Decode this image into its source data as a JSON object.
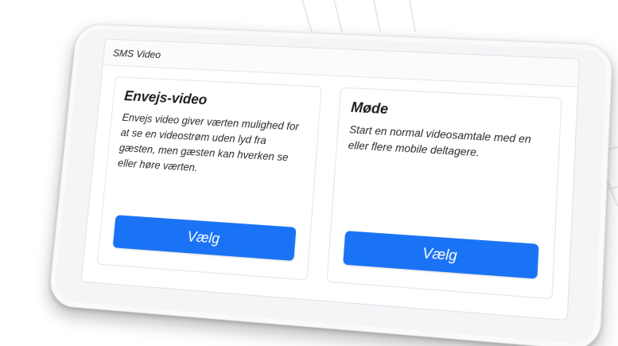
{
  "panel": {
    "title": "SMS Video"
  },
  "options": [
    {
      "title": "Envejs-video",
      "description": "Envejs video giver værten mulighed for at se en videostrøm uden lyd fra gæsten, men gæsten kan hverken se eller høre værten.",
      "button_label": "Vælg"
    },
    {
      "title": "Møde",
      "description": "Start en normal videosamtale med en eller flere mobile deltagere.",
      "button_label": "Vælg"
    }
  ],
  "colors": {
    "accent": "#1a73f5",
    "frame": "#f4f5f7",
    "panel": "#ffffff"
  }
}
